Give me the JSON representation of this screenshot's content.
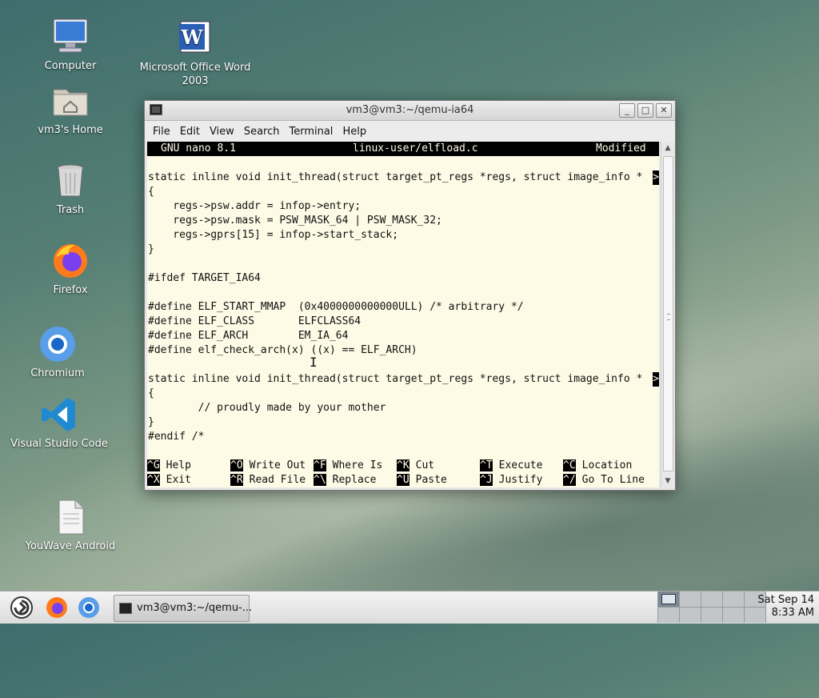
{
  "desktop_icons": [
    {
      "label": "Computer",
      "icon": "computer-icon"
    },
    {
      "label": "Microsoft Office Word 2003",
      "icon": "word-icon"
    },
    {
      "label": "vm3's Home",
      "icon": "home-folder-icon"
    },
    {
      "label": "Trash",
      "icon": "trash-icon"
    },
    {
      "label": "Firefox",
      "icon": "firefox-icon"
    },
    {
      "label": "Chromium",
      "icon": "chromium-icon"
    },
    {
      "label": "Visual Studio Code",
      "icon": "vscode-icon"
    },
    {
      "label": "YouWave Android",
      "icon": "document-icon"
    }
  ],
  "window": {
    "title": "vm3@vm3:~/qemu-ia64",
    "menu": [
      "File",
      "Edit",
      "View",
      "Search",
      "Terminal",
      "Help"
    ]
  },
  "nano": {
    "version": "GNU nano 8.1",
    "filename": "linux-user/elfload.c",
    "status": "Modified",
    "more_marker": ">",
    "lines": [
      "",
      "static inline void init_thread(struct target_pt_regs *regs, struct image_info *",
      "{",
      "    regs->psw.addr = infop->entry;",
      "    regs->psw.mask = PSW_MASK_64 | PSW_MASK_32;",
      "    regs->gprs[15] = infop->start_stack;",
      "}",
      "",
      "#ifdef TARGET_IA64",
      "",
      "#define ELF_START_MMAP  (0x4000000000000ULL) /* arbitrary */",
      "#define ELF_CLASS       ELFCLASS64",
      "#define ELF_ARCH        EM_IA_64",
      "#define elf_check_arch(x) ((x) == ELF_ARCH)",
      "",
      "static inline void init_thread(struct target_pt_regs *regs, struct image_info *",
      "{",
      "        // proudly made by your mother",
      "}",
      "#endif /*",
      ""
    ],
    "shortcuts_row1": [
      {
        "key": "^G",
        "label": "Help"
      },
      {
        "key": "^O",
        "label": "Write Out"
      },
      {
        "key": "^F",
        "label": "Where Is"
      },
      {
        "key": "^K",
        "label": "Cut"
      },
      {
        "key": "^T",
        "label": "Execute"
      },
      {
        "key": "^C",
        "label": "Location"
      }
    ],
    "shortcuts_row2": [
      {
        "key": "^X",
        "label": "Exit"
      },
      {
        "key": "^R",
        "label": "Read File"
      },
      {
        "key": "^\\",
        "label": "Replace"
      },
      {
        "key": "^U",
        "label": "Paste"
      },
      {
        "key": "^J",
        "label": "Justify"
      },
      {
        "key": "^/",
        "label": "Go To Line"
      }
    ]
  },
  "taskbar": {
    "task_label": "vm3@vm3:~/qemu-...",
    "date": "Sat Sep 14",
    "time": "8:33 AM"
  }
}
